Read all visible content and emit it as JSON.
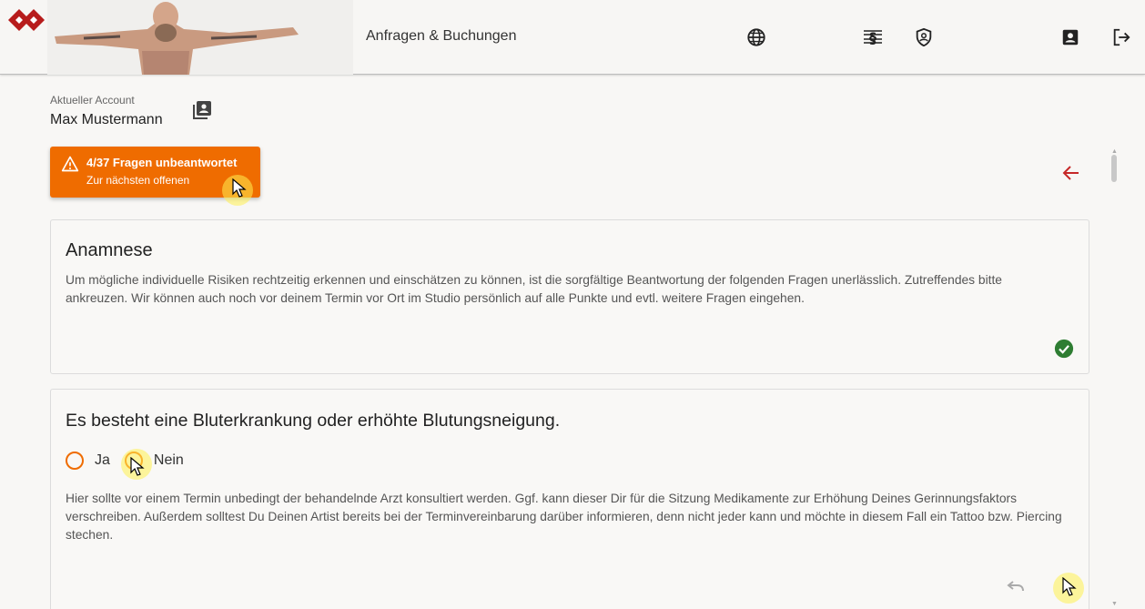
{
  "header": {
    "nav_title": "Anfragen & Buchungen",
    "icons": [
      "logo-icon",
      "globe-icon",
      "paragraph-law-icon",
      "shield-user-icon",
      "account-box-icon",
      "logout-icon"
    ]
  },
  "account": {
    "label": "Aktueller Account",
    "name": "Max Mustermann"
  },
  "warning": {
    "title": "4/37 Fragen unbeantwortet",
    "subtitle": "Zur nächsten offenen",
    "color": "#ef6c00"
  },
  "cards": [
    {
      "title": "Anamnese",
      "description": "Um mögliche individuelle Risiken rechtzeitig erkennen und einschätzen zu können, ist die sorgfältige Beantwortung der folgenden Fragen unerlässlich. Zutreffendes bitte ankreuzen. Wir können auch noch vor deinem Termin vor Ort im Studio persönlich auf alle Punkte und evtl. weitere Fragen eingehen."
    },
    {
      "title": "Es besteht eine Bluterkrankung oder erhöhte Blutungsneigung.",
      "options": [
        "Ja",
        "Nein"
      ],
      "description": "Hier sollte vor einem Termin unbedingt der behandelnde Arzt konsultiert werden. Ggf. kann dieser Dir für die Sitzung Medikamente zur Erhöhung Deines Gerinnungsfaktors verschreiben. Außerdem solltest Du Deinen Artist bereits bei der Terminvereinbarung darüber informieren, denn nicht jeder kann und möchte in diesem Fall ein Tattoo bzw. Piercing stechen."
    }
  ],
  "colors": {
    "accent": "#ef6c00",
    "success": "#2e7d32",
    "back_arrow": "#c62828",
    "brand": "#b71c1c"
  }
}
